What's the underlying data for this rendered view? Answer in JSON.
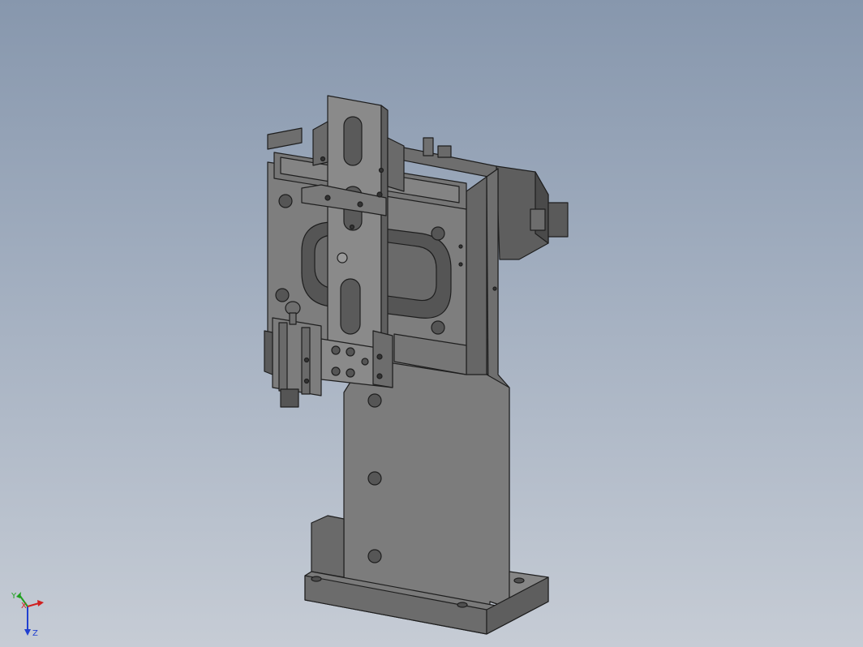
{
  "view": {
    "background_top": "#8797ad",
    "background_bottom": "#c6ccd5",
    "model_color": "#7c7c7c",
    "edge_color": "#1e1e1e"
  },
  "triad": {
    "x_label": "X",
    "y_label": "Y",
    "z_label": "Z",
    "x_color": "#d02020",
    "y_color": "#20a020",
    "z_color": "#2040d0"
  }
}
